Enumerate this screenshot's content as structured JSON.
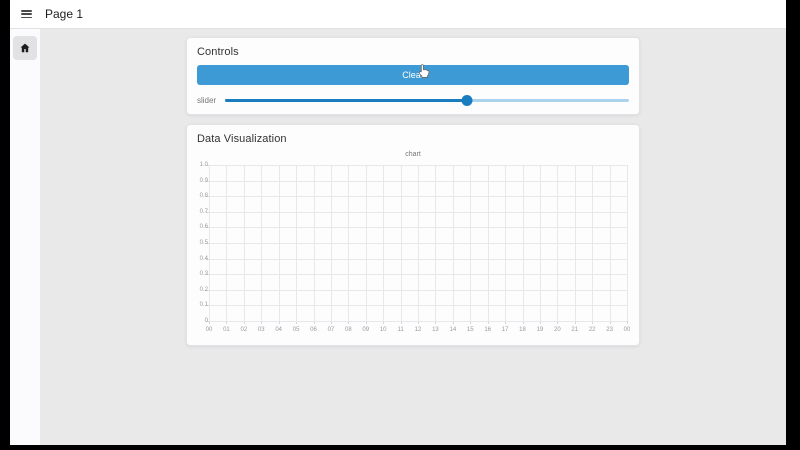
{
  "topbar": {
    "title": "Page 1",
    "menu_icon": "hamburger-icon"
  },
  "sidebar": {
    "home_icon": "home-icon"
  },
  "controls": {
    "title": "Controls",
    "clear_button_label": "Clear",
    "slider": {
      "label": "slider",
      "value_percent": 60
    }
  },
  "visualization": {
    "title": "Data Visualization"
  },
  "chart_data": {
    "type": "line",
    "title": "chart",
    "series": [],
    "x_ticks": [
      "00",
      "01",
      "02",
      "03",
      "04",
      "05",
      "06",
      "07",
      "08",
      "09",
      "10",
      "11",
      "12",
      "13",
      "14",
      "15",
      "16",
      "17",
      "18",
      "19",
      "20",
      "21",
      "22",
      "23",
      "00"
    ],
    "y_ticks": [
      "1.0",
      "0.9",
      "0.8",
      "0.7",
      "0.6",
      "0.5",
      "0.4",
      "0.3",
      "0.2",
      "0.1",
      "0"
    ],
    "ylim": [
      0,
      1
    ],
    "grid": true,
    "legend": false
  },
  "colors": {
    "button_blue": "#3e9ad4",
    "slider_fill": "#1a7dc0",
    "slider_rest": "#abd3ec",
    "grid_line": "#e8e8ec"
  }
}
